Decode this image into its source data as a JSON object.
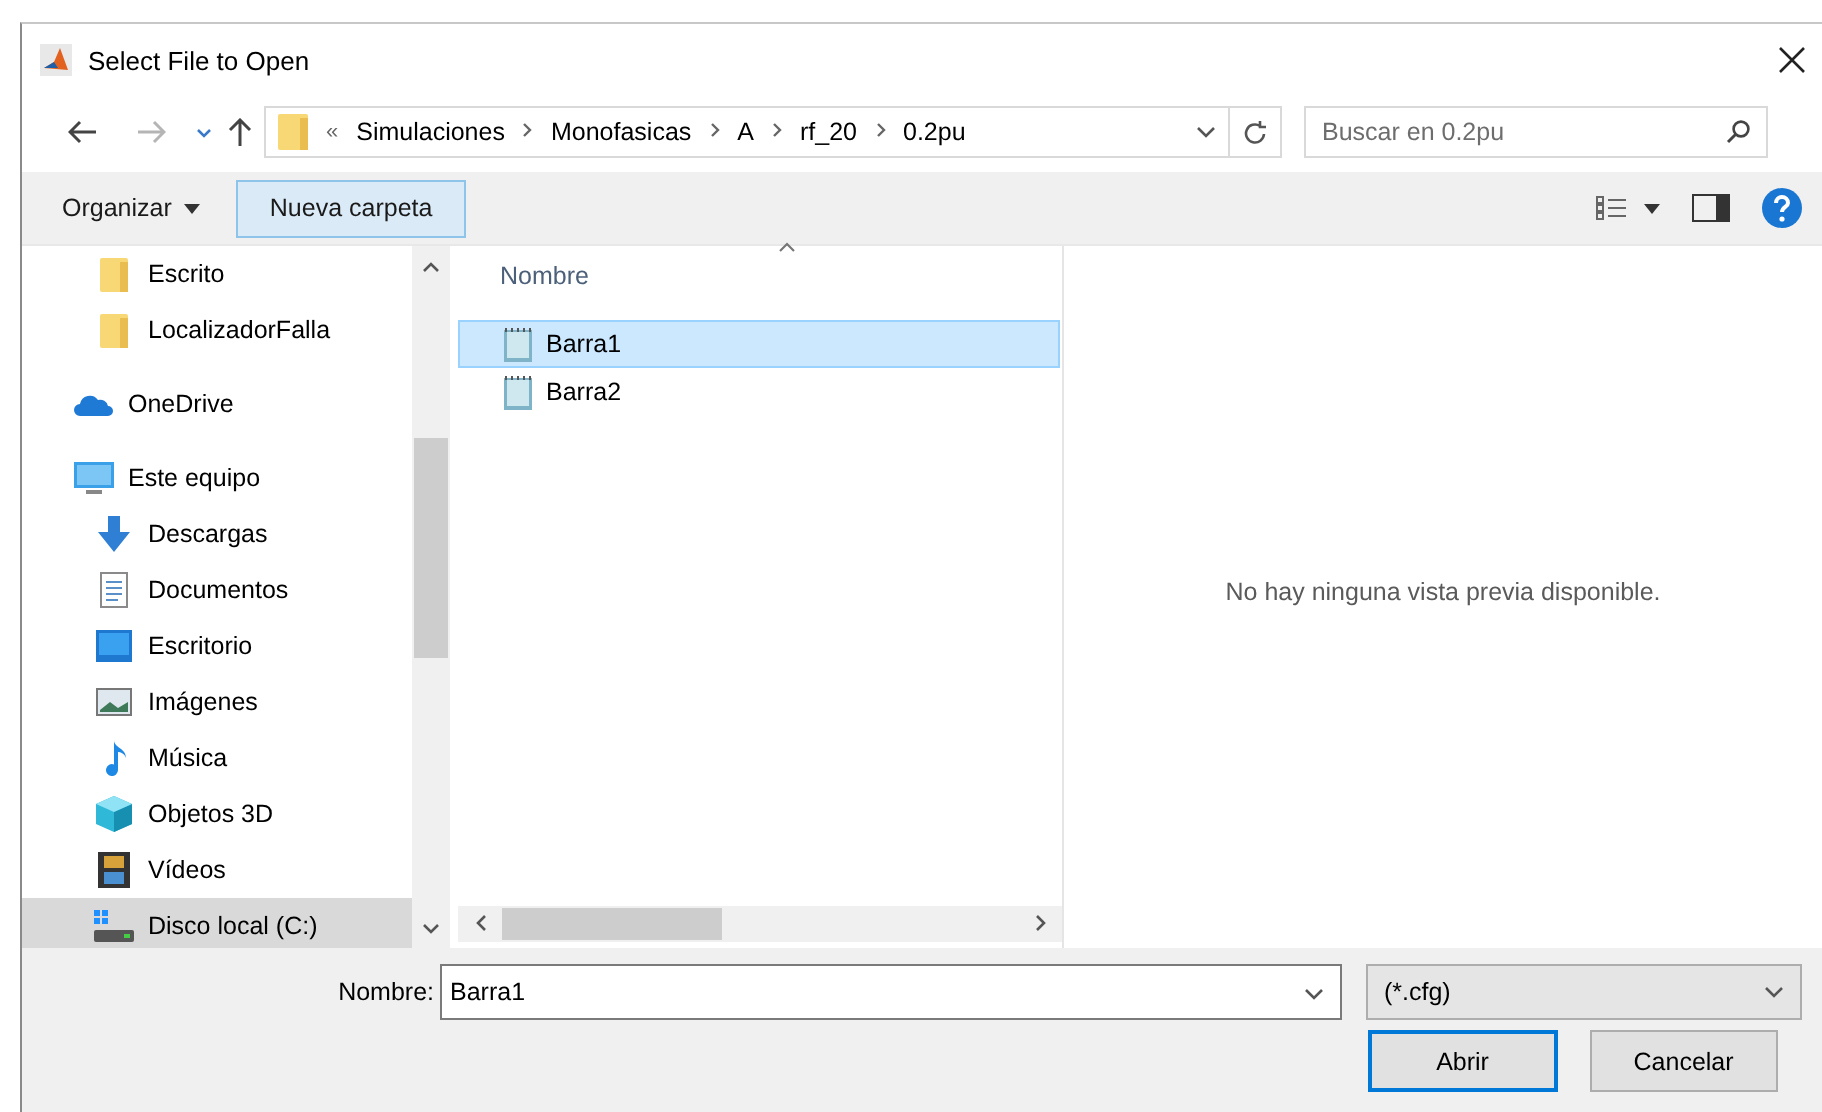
{
  "window": {
    "title": "Select File to Open"
  },
  "address": {
    "breadcrumbs": [
      "Simulaciones",
      "Monofasicas",
      "A",
      "rf_20",
      "0.2pu"
    ],
    "overflow": "«"
  },
  "search": {
    "placeholder": "Buscar en 0.2pu"
  },
  "toolbar": {
    "organize": "Organizar",
    "new_folder": "Nueva carpeta"
  },
  "nav": {
    "quick_access": [
      {
        "label": "Escrito",
        "kind": "folder",
        "selected": false
      },
      {
        "label": "LocalizadorFalla",
        "kind": "folder",
        "selected": false
      }
    ],
    "items": [
      {
        "label": "OneDrive",
        "kind": "cloud",
        "selected": false
      },
      {
        "label": "Este equipo",
        "kind": "pc",
        "selected": false,
        "children": [
          {
            "label": "Descargas",
            "kind": "download",
            "selected": false
          },
          {
            "label": "Documentos",
            "kind": "document",
            "selected": false
          },
          {
            "label": "Escritorio",
            "kind": "desktop",
            "selected": false
          },
          {
            "label": "Imágenes",
            "kind": "pictures",
            "selected": false
          },
          {
            "label": "Música",
            "kind": "music",
            "selected": false
          },
          {
            "label": "Objetos 3D",
            "kind": "cube",
            "selected": false
          },
          {
            "label": "Vídeos",
            "kind": "video",
            "selected": false
          },
          {
            "label": "Disco local (C:)",
            "kind": "disk",
            "selected": true
          }
        ]
      }
    ]
  },
  "files": {
    "column": "Nombre",
    "items": [
      {
        "name": "Barra1",
        "selected": true
      },
      {
        "name": "Barra2",
        "selected": false
      }
    ]
  },
  "preview": {
    "message": "No hay ninguna vista previa disponible."
  },
  "footer": {
    "name_label": "Nombre:",
    "name_value": "Barra1",
    "filter": "(*.cfg)",
    "buttons": [
      "Abrir",
      "Cancelar"
    ]
  }
}
